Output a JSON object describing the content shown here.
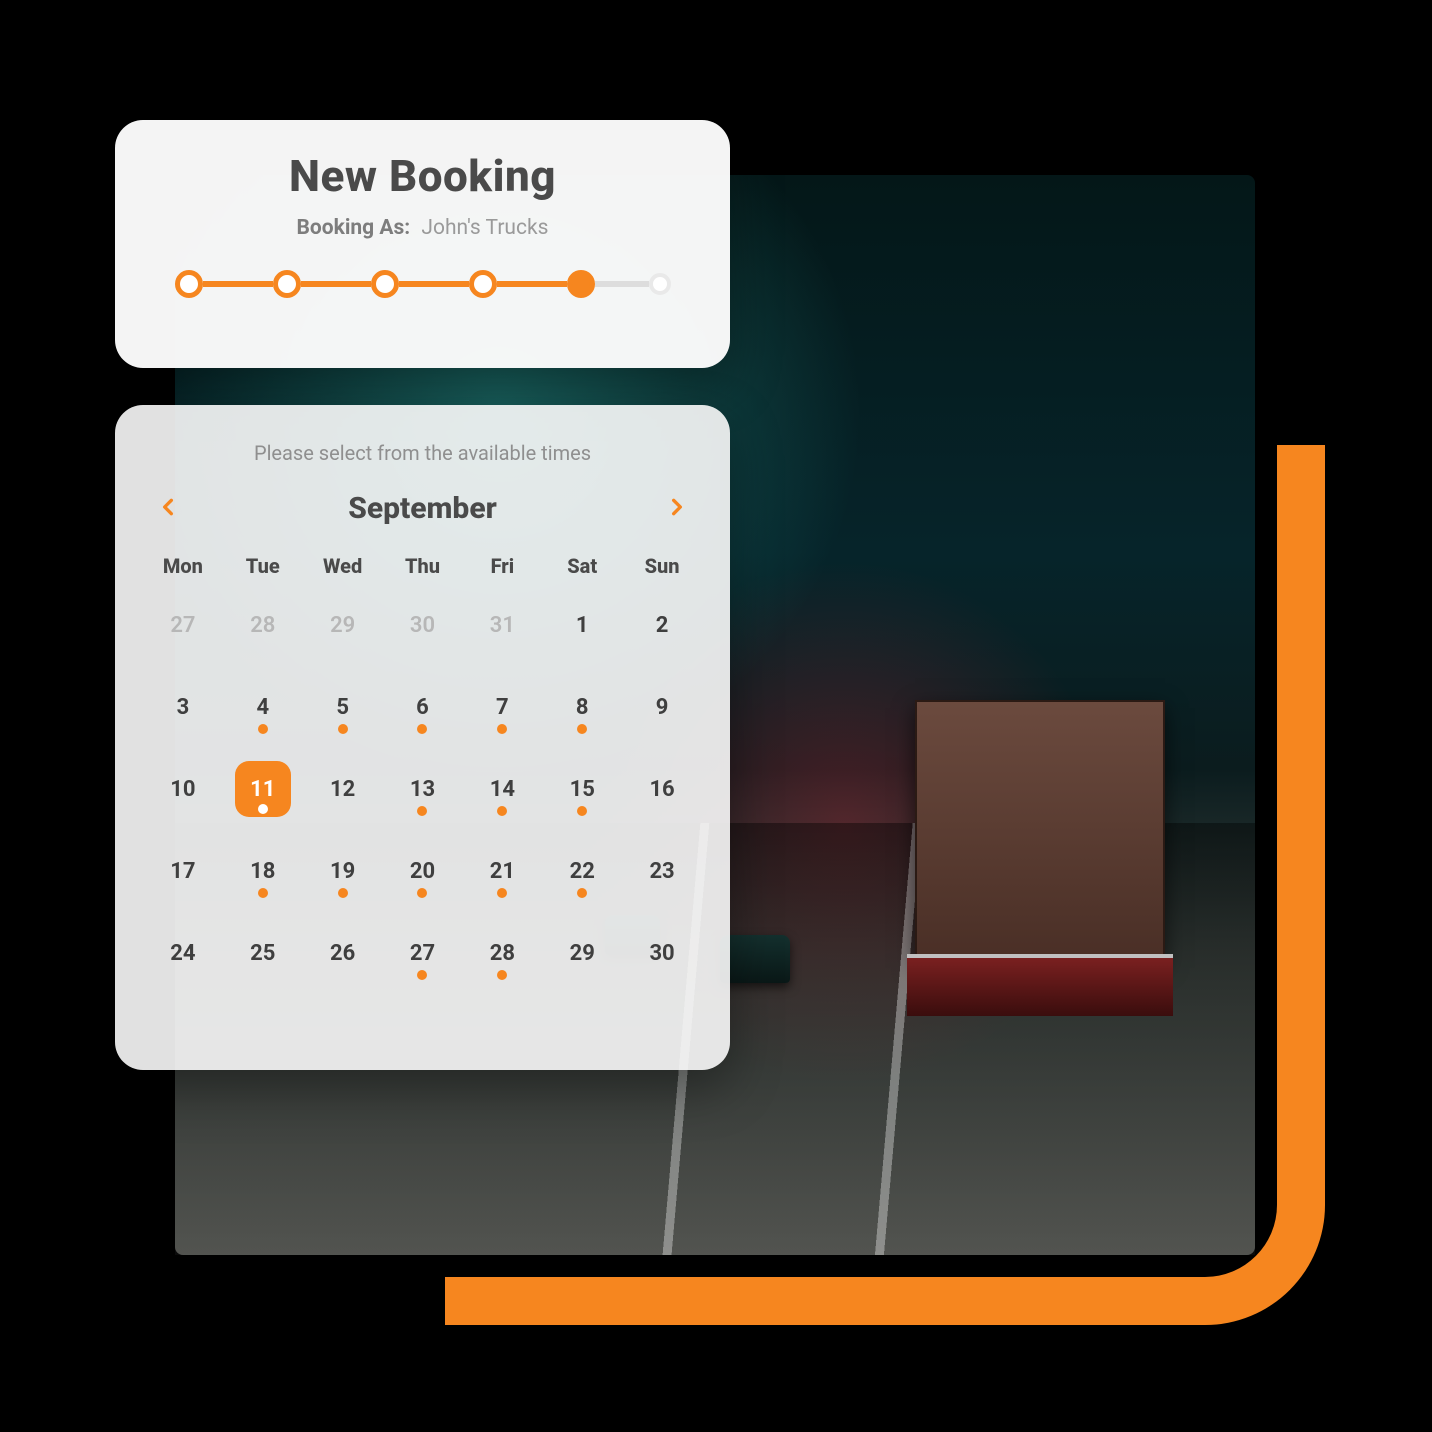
{
  "colors": {
    "accent": "#f6861f",
    "text": "#4a4a4a",
    "muted": "#8f8f8f"
  },
  "booking": {
    "title": "New Booking",
    "as_label": "Booking As:",
    "as_value": "John's Trucks",
    "steps_total": 6,
    "steps_current_index": 4
  },
  "calendar": {
    "hint": "Please select from the available times",
    "month_label": "September",
    "weekdays": [
      "Mon",
      "Tue",
      "Wed",
      "Thu",
      "Fri",
      "Sat",
      "Sun"
    ],
    "selected_day": 11,
    "days": [
      {
        "n": 27,
        "out": true
      },
      {
        "n": 28,
        "out": true
      },
      {
        "n": 29,
        "out": true
      },
      {
        "n": 30,
        "out": true
      },
      {
        "n": 31,
        "out": true
      },
      {
        "n": 1
      },
      {
        "n": 2
      },
      {
        "n": 3
      },
      {
        "n": 4,
        "avail": true
      },
      {
        "n": 5,
        "avail": true
      },
      {
        "n": 6,
        "avail": true
      },
      {
        "n": 7,
        "avail": true
      },
      {
        "n": 8,
        "avail": true
      },
      {
        "n": 9
      },
      {
        "n": 10
      },
      {
        "n": 11,
        "avail": true,
        "selected": true
      },
      {
        "n": 12
      },
      {
        "n": 13,
        "avail": true
      },
      {
        "n": 14,
        "avail": true
      },
      {
        "n": 15,
        "avail": true
      },
      {
        "n": 16
      },
      {
        "n": 17
      },
      {
        "n": 18,
        "avail": true
      },
      {
        "n": 19,
        "avail": true
      },
      {
        "n": 20,
        "avail": true
      },
      {
        "n": 21,
        "avail": true
      },
      {
        "n": 22,
        "avail": true
      },
      {
        "n": 23
      },
      {
        "n": 24
      },
      {
        "n": 25
      },
      {
        "n": 26
      },
      {
        "n": 27,
        "avail": true
      },
      {
        "n": 28,
        "avail": true
      },
      {
        "n": 29
      },
      {
        "n": 30
      }
    ]
  }
}
